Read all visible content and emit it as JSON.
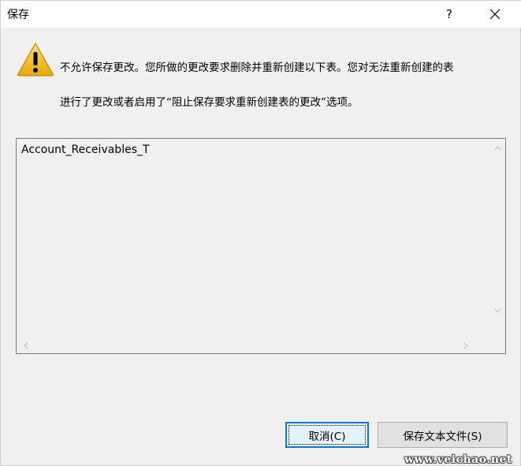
{
  "window": {
    "title": "保存",
    "help_label": "?"
  },
  "message": {
    "line1": "不允许保存更改。您所做的更改要求删除并重新创建以下表。您对无法重新创建的表",
    "line2": "进行了更改或者启用了“阻止保存要求重新创建表的更改”选项。",
    "icon": "warning-icon"
  },
  "list": {
    "items": [
      "Account_Receivables_T"
    ]
  },
  "buttons": {
    "cancel_label": "取消(C)",
    "save_text_label": "保存文本文件(S)"
  },
  "watermark": {
    "text": "www.veichao.net"
  },
  "colors": {
    "focus_border": "#0078d7",
    "dialog_bg": "#f0f0f0",
    "warning_yellow": "#f2c200"
  }
}
